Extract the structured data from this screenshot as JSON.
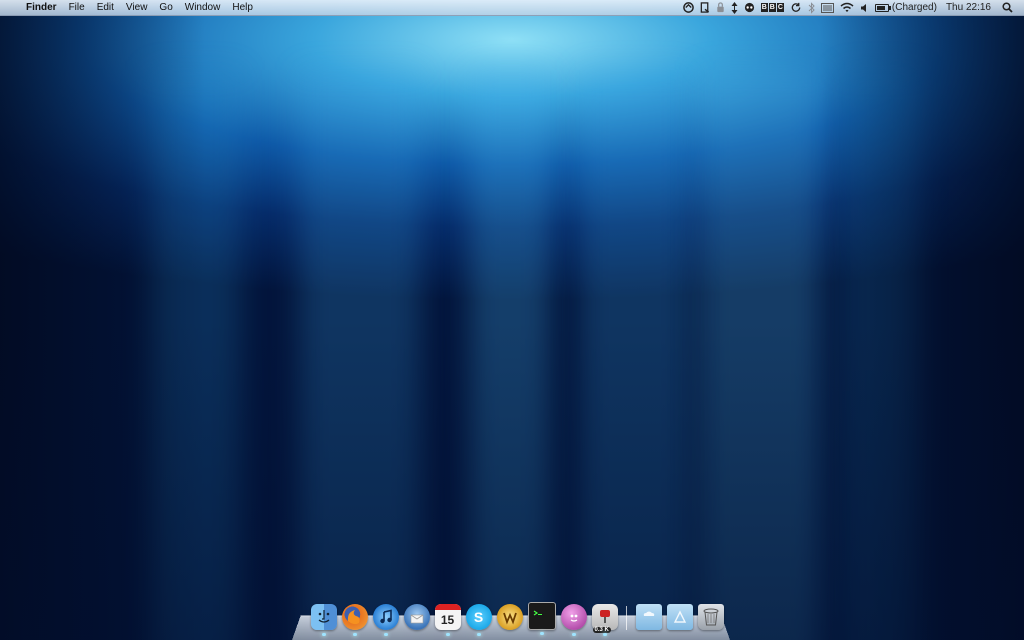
{
  "menubar": {
    "apple_glyph": "",
    "app_name": "Finder",
    "menus": [
      "File",
      "Edit",
      "View",
      "Go",
      "Window",
      "Help"
    ],
    "status": {
      "battery_text": "(Charged)",
      "clock": "Thu 22:16",
      "bbc_letters": [
        "B",
        "B",
        "C"
      ]
    },
    "tray_icons": [
      "sync-icon",
      "script-icon",
      "lock-icon",
      "up-down-arrows-icon",
      "remote-icon",
      "bbc-icon",
      "time-machine-icon",
      "bluetooth-icon",
      "menu-meter-icon",
      "wifi-icon",
      "volume-icon",
      "battery-icon",
      "spotlight-icon"
    ]
  },
  "dock": {
    "apps": [
      {
        "name": "finder",
        "icon": "finder-icon",
        "color": "#5aa7e6"
      },
      {
        "name": "firefox",
        "icon": "firefox-icon",
        "color": "#e8731f"
      },
      {
        "name": "itunes",
        "icon": "itunes-icon",
        "color": "#2a7fd4"
      },
      {
        "name": "thunderbird",
        "icon": "thunderbird-icon",
        "color": "#3b74b8"
      },
      {
        "name": "ical",
        "icon": "calendar-icon",
        "color": "#f4f4f4",
        "text": "15"
      },
      {
        "name": "skype",
        "icon": "skype-icon",
        "color": "#1ba8e8",
        "text": "S"
      },
      {
        "name": "transmit",
        "icon": "transmit-icon",
        "color": "#d79a1b"
      },
      {
        "name": "terminal",
        "icon": "terminal-icon",
        "color": "#1a1a1a"
      },
      {
        "name": "adium",
        "icon": "adium-icon",
        "color": "#b14aa8"
      },
      {
        "name": "transmission",
        "icon": "transmission-icon",
        "color": "#c8c8c8",
        "badge": "0.3 K"
      }
    ],
    "folders": [
      {
        "name": "downloads",
        "icon": "downloads-folder-icon",
        "color": "#8ec6ea"
      },
      {
        "name": "applications",
        "icon": "applications-folder-icon",
        "color": "#8ec6ea"
      },
      {
        "name": "trash",
        "icon": "trash-icon",
        "color": "#b8bec6"
      }
    ]
  }
}
